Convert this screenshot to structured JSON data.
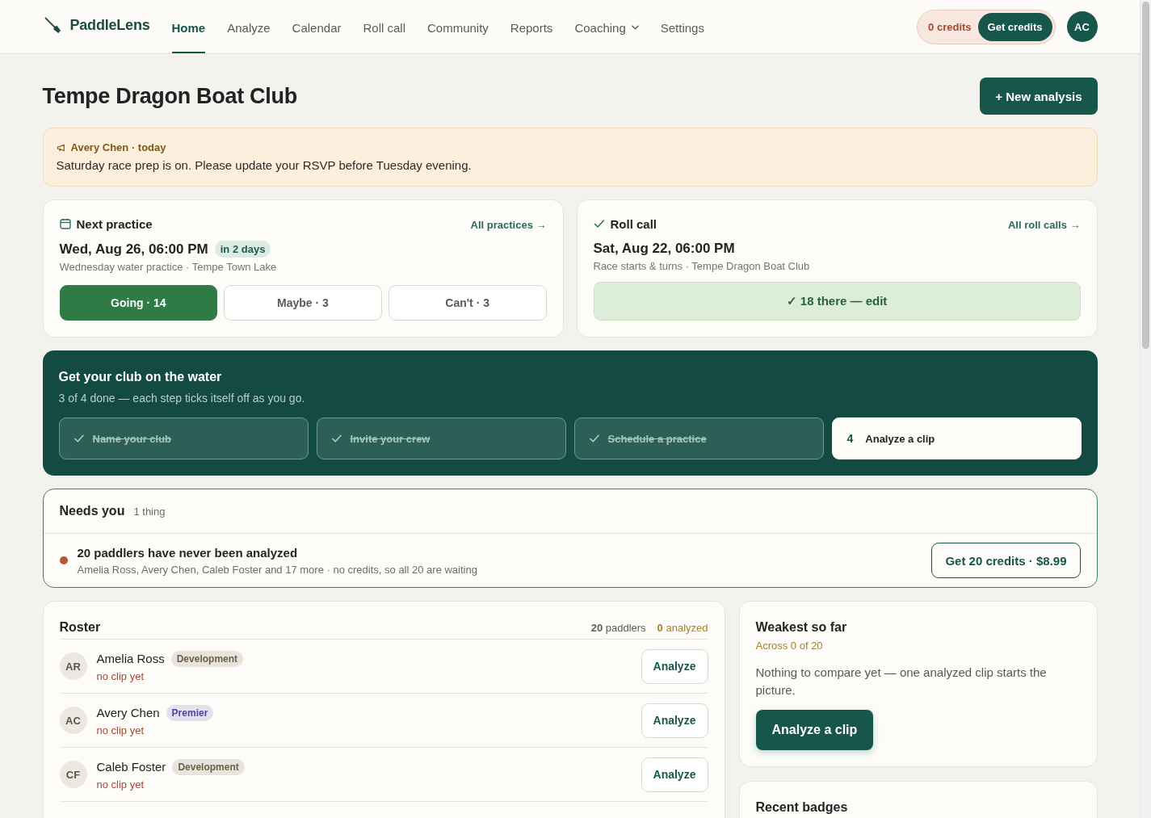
{
  "nav": {
    "brand": "PaddleLens",
    "items": [
      {
        "label": "Home",
        "selected": true,
        "kind": "link"
      },
      {
        "label": "Analyze",
        "selected": false,
        "kind": "link"
      },
      {
        "label": "Calendar",
        "selected": false,
        "kind": "link"
      },
      {
        "label": "Roll call",
        "selected": false,
        "kind": "link"
      },
      {
        "label": "Community",
        "selected": false,
        "kind": "link"
      },
      {
        "label": "Reports",
        "selected": false,
        "kind": "link"
      },
      {
        "label": "Coaching",
        "selected": false,
        "kind": "menu"
      },
      {
        "label": "Settings",
        "selected": false,
        "kind": "link"
      }
    ],
    "credits": {
      "balance": "0 credits",
      "button": "Get credits"
    },
    "avatar": "AC"
  },
  "header": {
    "title": "Tempe Dragon Boat Club",
    "button": "+ New analysis"
  },
  "announcement": {
    "author": "Avery Chen · today",
    "message": "Saturday race prep is on. Please update your RSVP before Tuesday evening."
  },
  "next_practice": {
    "title": "Next practice",
    "link": "All practices →",
    "date": "Wed, Aug 26, 06:00 PM",
    "badge": "in 2 days",
    "details": "Wednesday water practice · Tempe Town Lake",
    "rsvp": [
      {
        "label": "Going · 14",
        "selected": true
      },
      {
        "label": "Maybe · 3",
        "selected": false
      },
      {
        "label": "Can't · 3",
        "selected": false
      }
    ]
  },
  "roll_call": {
    "title": "Roll call",
    "link": "All roll calls →",
    "date": "Sat, Aug 22, 06:00 PM",
    "details": "Race starts & turns · Tempe Dragon Boat Club",
    "button": "✓ 18 there — edit"
  },
  "setup": {
    "title": "Get your club on the water",
    "subtitle": "3 of 4 done — each step ticks itself off as you go.",
    "steps": [
      {
        "label": "Name your club",
        "done": true
      },
      {
        "label": "Invite your crew",
        "done": true
      },
      {
        "label": "Schedule a practice",
        "done": true
      },
      {
        "number": "4",
        "label": "Analyze a clip",
        "done": false
      }
    ]
  },
  "needs_you": {
    "title": "Needs you",
    "count": "1 thing",
    "items": [
      {
        "color": "#b5583a",
        "title": "20 paddlers have never been analyzed",
        "details": "Amelia Ross, Avery Chen, Caleb Foster and 17 more · no credits, so all 20 are waiting",
        "button": "Get 20 credits · $8.99"
      }
    ]
  },
  "roster": {
    "title": "Roster",
    "paddlers": "**20** paddlers",
    "analyzed": "**0** analyzed",
    "rows": [
      {
        "initials": "AR",
        "name": "Amelia Ross",
        "tag": {
          "label": "Development",
          "color": "#6b5f45"
        },
        "status": "no clip yet",
        "button": "Analyze"
      },
      {
        "initials": "AC",
        "name": "Avery Chen",
        "tag": {
          "label": "Premier",
          "color": "#4d46a0"
        },
        "status": "no clip yet",
        "button": "Analyze"
      },
      {
        "initials": "CF",
        "name": "Caleb Foster",
        "tag": {
          "label": "Development",
          "color": "#6b5f45"
        },
        "status": "no clip yet",
        "button": "Analyze"
      }
    ]
  },
  "weakest": {
    "title": "Weakest so far",
    "subtitle": "Across 0 of 20",
    "text": "Nothing to compare yet — one analyzed clip starts the picture.",
    "button": "Analyze a clip"
  },
  "recent_badges": {
    "title": "Recent badges"
  }
}
